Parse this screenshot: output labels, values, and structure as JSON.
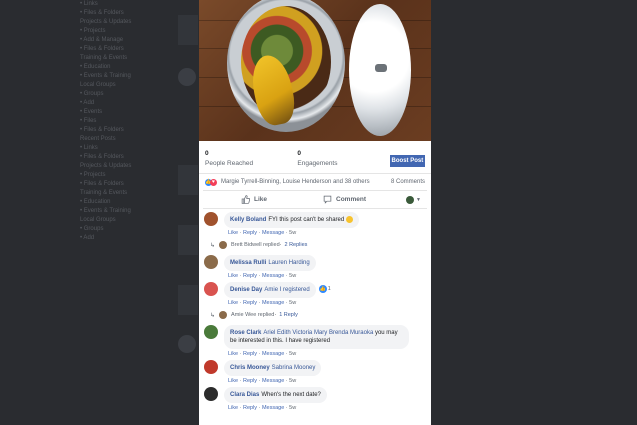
{
  "background_feed": {
    "column_text": [
      "• Links",
      "• Files & Folders",
      "",
      "Projects & Updates",
      "• Projects",
      "• Add & Manage",
      "• Files & Folders",
      "",
      "Training & Events",
      "• Education",
      "• Events & Training",
      "",
      "Local Groups",
      "• Groups",
      "• Add",
      "• Events",
      "• Files",
      "• Files & Folders",
      "",
      "Recent Posts",
      "• Links",
      "• Files & Folders",
      "",
      "Projects & Updates",
      "• Projects",
      "• Files & Folders",
      "",
      "Training & Events",
      "• Education",
      "• Events & Training",
      "",
      "Local Groups",
      "• Groups",
      "• Add"
    ]
  },
  "post": {
    "photo_alt": "Compost bin with food scraps and a banana peel",
    "stats": [
      {
        "number": "0",
        "label": "People Reached"
      },
      {
        "number": "0",
        "label": "Engagements"
      }
    ],
    "boost_label": "Boost Post",
    "reactions_names": "Margie Tyrrell-Binning, Louise Henderson and 38 others",
    "comments_count": "8 Comments",
    "actions": {
      "like": "Like",
      "comment": "Comment"
    }
  },
  "comments": [
    {
      "author": "Kelly Boland",
      "text": "FYI this post can't be shared",
      "has_emoji": true,
      "tag": "",
      "actions": [
        "Like",
        "Reply",
        "Message"
      ],
      "time": "5w",
      "replies": {
        "who": "Brett Bidwell replied",
        "count": "2 Replies"
      },
      "avatar_color": "#a0522d"
    },
    {
      "author": "Melissa Rulli",
      "text": "",
      "tag": "Lauren Harding",
      "actions": [
        "Like",
        "Reply",
        "Message"
      ],
      "time": "5w",
      "avatar_color": "#8b6b4a"
    },
    {
      "author": "Denise Day",
      "text": "",
      "tag": "Amie I registered",
      "actions": [
        "Like",
        "Reply",
        "Message"
      ],
      "time": "5w",
      "badge": "1",
      "replies": {
        "who": "Amie Wee replied",
        "count": "1 Reply"
      },
      "avatar_color": "#d9534f"
    },
    {
      "author": "Rose Clark",
      "text": "you may be interested in this. I have registered",
      "tag": "Ariel Edith Victoria Mary Brenda Muraoka",
      "actions": [
        "Like",
        "Reply",
        "Message"
      ],
      "time": "5w",
      "avatar_color": "#4a7a3a"
    },
    {
      "author": "Chris Mooney",
      "text": "",
      "tag": "Sabrina Mooney",
      "actions": [
        "Like",
        "Reply",
        "Message"
      ],
      "time": "5w",
      "avatar_color": "#c0392b"
    },
    {
      "author": "Clara Dias",
      "text": "When's the next date?",
      "tag": "",
      "actions": [
        "Like",
        "Reply",
        "Message"
      ],
      "time": "5w",
      "avatar_color": "#2c2c2c"
    }
  ],
  "colors": {
    "link": "#385898",
    "boost": "#4267b2",
    "like_reaction": "#2d88ff",
    "love_reaction": "#f33e58"
  }
}
